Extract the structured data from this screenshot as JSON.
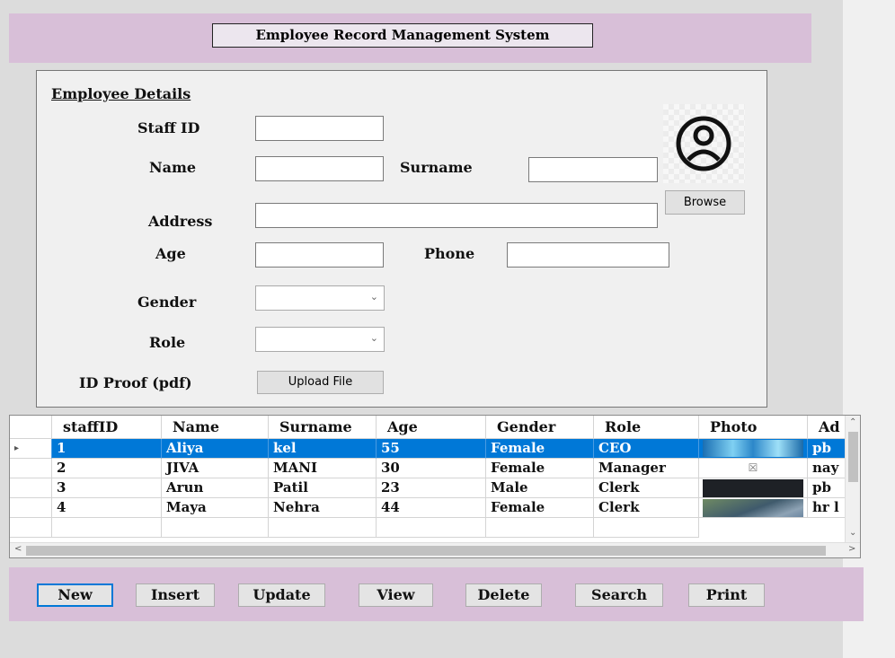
{
  "title": "Employee Record Management System",
  "form": {
    "section_title": "Employee Details",
    "staff_id_label": "Staff ID",
    "name_label": "Name",
    "surname_label": "Surname",
    "address_label": "Address",
    "age_label": "Age",
    "phone_label": "Phone",
    "gender_label": "Gender",
    "role_label": "Role",
    "id_proof_label": "ID Proof (pdf)",
    "staff_id_value": "",
    "name_value": "",
    "surname_value": "",
    "address_value": "",
    "age_value": "",
    "phone_value": "",
    "gender_selected": "",
    "role_selected": "",
    "upload_label": "Upload File",
    "browse_label": "Browse",
    "photo_icon": "user-avatar-icon"
  },
  "grid": {
    "columns": [
      "staffID",
      "Name",
      "Surname",
      "Age",
      "Gender",
      "Role",
      "Photo",
      "Ad"
    ],
    "rows": [
      {
        "staffID": "1",
        "Name": "Aliya",
        "Surname": "kel",
        "Age": "55",
        "Gender": "Female",
        "Role": "CEO",
        "Photo": "",
        "Address": "pb",
        "selected": true
      },
      {
        "staffID": "2",
        "Name": "JIVA",
        "Surname": "MANI",
        "Age": "30",
        "Gender": "Female",
        "Role": "Manager",
        "Photo": "☒",
        "Address": "nay",
        "selected": false
      },
      {
        "staffID": "3",
        "Name": "Arun",
        "Surname": "Patil",
        "Age": "23",
        "Gender": "Male",
        "Role": "Clerk",
        "Photo": "",
        "Address": "pb",
        "selected": false
      },
      {
        "staffID": "4",
        "Name": "Maya",
        "Surname": "Nehra",
        "Age": "44",
        "Gender": "Female",
        "Role": "Clerk",
        "Photo": "",
        "Address": "hr l",
        "selected": false
      }
    ]
  },
  "actions": {
    "new": "New",
    "insert": "Insert",
    "update": "Update",
    "view": "View",
    "delete": "Delete",
    "search": "Search",
    "print": "Print"
  },
  "colors": {
    "band": "#d8bfd8",
    "selection": "#0078d7",
    "background": "#dcdcdc"
  }
}
